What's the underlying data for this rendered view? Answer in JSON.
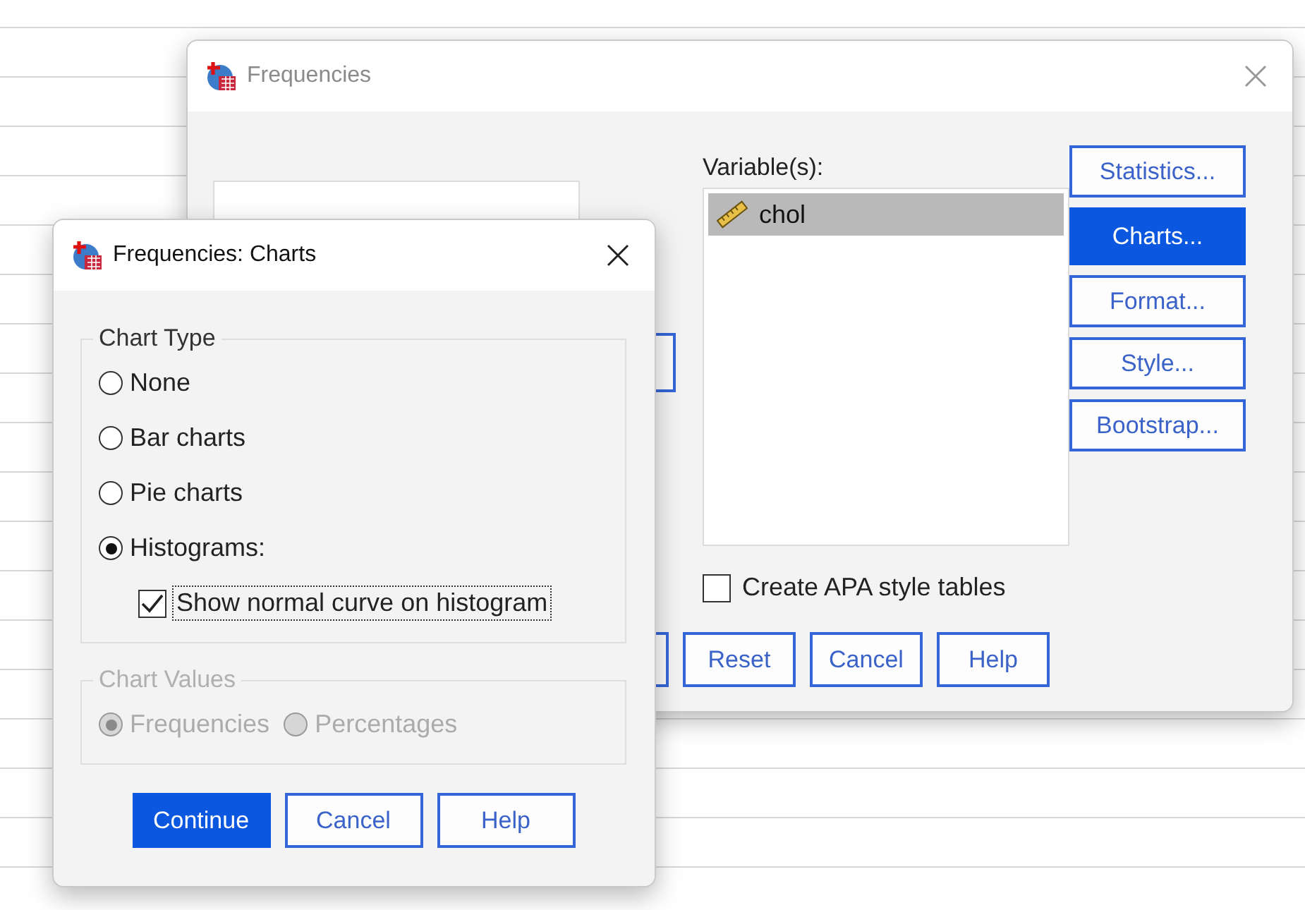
{
  "main_dialog": {
    "title": "Frequencies",
    "variables_label": "Variable(s):",
    "variables": [
      {
        "name": "chol",
        "selected": true
      }
    ],
    "side_buttons": [
      {
        "label": "Statistics...",
        "selected": false
      },
      {
        "label": "Charts...",
        "selected": true
      },
      {
        "label": "Format...",
        "selected": false
      },
      {
        "label": "Style...",
        "selected": false
      },
      {
        "label": "Bootstrap...",
        "selected": false
      }
    ],
    "apa_checkbox": {
      "label": "Create APA style tables",
      "checked": false
    },
    "buttons": [
      "Reset",
      "Cancel",
      "Help"
    ]
  },
  "charts_dialog": {
    "title": "Frequencies: Charts",
    "chart_type": {
      "legend": "Chart Type",
      "options": [
        {
          "label": "None",
          "selected": false
        },
        {
          "label": "Bar charts",
          "selected": false
        },
        {
          "label": "Pie charts",
          "selected": false
        },
        {
          "label": "Histograms:",
          "selected": true
        }
      ],
      "normal_curve": {
        "label": "Show normal curve on histogram",
        "checked": true
      }
    },
    "chart_values": {
      "legend": "Chart Values",
      "disabled": true,
      "options": [
        {
          "label": "Frequencies",
          "selected": true
        },
        {
          "label": "Percentages",
          "selected": false
        }
      ]
    },
    "buttons": [
      {
        "label": "Continue",
        "default": true
      },
      {
        "label": "Cancel",
        "default": false
      },
      {
        "label": "Help",
        "default": false
      }
    ]
  }
}
